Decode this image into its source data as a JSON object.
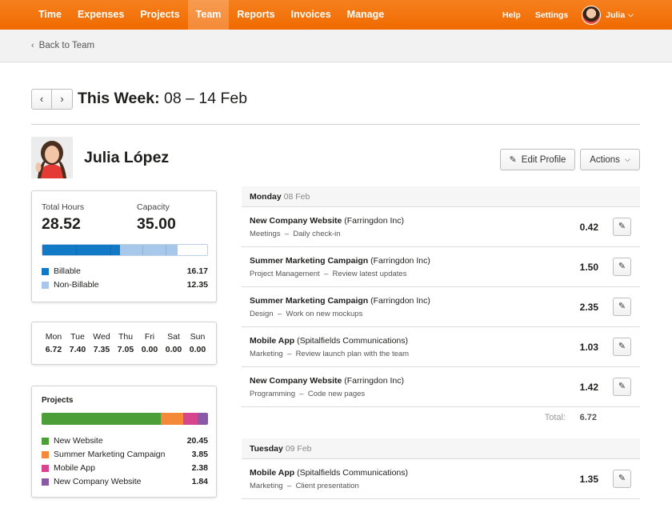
{
  "nav": {
    "items": [
      {
        "label": "Time"
      },
      {
        "label": "Expenses"
      },
      {
        "label": "Projects"
      },
      {
        "label": "Team"
      },
      {
        "label": "Reports"
      },
      {
        "label": "Invoices"
      },
      {
        "label": "Manage"
      }
    ],
    "active": "Team",
    "help": "Help",
    "settings": "Settings",
    "user": "Julia",
    "brand_color": "#f36c00"
  },
  "subbar": {
    "back_label": "Back to Team"
  },
  "week": {
    "prefix": "This Week:",
    "range": "08 – 14 Feb"
  },
  "person": {
    "name": "Julia López"
  },
  "actions": {
    "edit_profile": "Edit Profile",
    "actions": "Actions"
  },
  "hours": {
    "total_label": "Total Hours",
    "total_value": "28.52",
    "capacity_label": "Capacity",
    "capacity_value": "35.00",
    "billable_fraction": 0.47,
    "non_billable_fraction": 0.35,
    "billable_label": "Billable",
    "billable_value": "16.17",
    "non_billable_label": "Non-Billable",
    "non_billable_value": "12.35",
    "billable_color": "#1179c6",
    "non_billable_color": "#a7c8ea"
  },
  "days": [
    {
      "name": "Mon",
      "value": "6.72"
    },
    {
      "name": "Tue",
      "value": "7.40"
    },
    {
      "name": "Wed",
      "value": "7.35"
    },
    {
      "name": "Thu",
      "value": "7.05"
    },
    {
      "name": "Fri",
      "value": "0.00"
    },
    {
      "name": "Sat",
      "value": "0.00"
    },
    {
      "name": "Sun",
      "value": "0.00"
    }
  ],
  "projects": {
    "title": "Projects",
    "items": [
      {
        "name": "New Website",
        "value": "20.45",
        "color": "#4c9f38"
      },
      {
        "name": "Summer Marketing Campaign",
        "value": "3.85",
        "color": "#f5893a"
      },
      {
        "name": "Mobile App",
        "value": "2.38",
        "color": "#d8458f"
      },
      {
        "name": "New Company Website",
        "value": "1.84",
        "color": "#8b5aa6"
      }
    ]
  },
  "monday": {
    "day": "Monday",
    "date": "08 Feb",
    "entries": [
      {
        "project": "New Company Website",
        "client": "(Farringdon Inc)",
        "task": "Meetings",
        "note": "Daily check-in",
        "hours": "0.42"
      },
      {
        "project": "Summer Marketing Campaign",
        "client": "(Farringdon Inc)",
        "task": "Project Management",
        "note": "Review latest updates",
        "hours": "1.50"
      },
      {
        "project": "Summer Marketing Campaign",
        "client": "(Farringdon Inc)",
        "task": "Design",
        "note": "Work on new mockups",
        "hours": "2.35"
      },
      {
        "project": "Mobile App",
        "client": "(Spitalfields Communications)",
        "task": "Marketing",
        "note": "Review launch plan with the team",
        "hours": "1.03"
      },
      {
        "project": "New Company Website",
        "client": "(Farringdon Inc)",
        "task": "Programming",
        "note": "Code new pages",
        "hours": "1.42"
      }
    ],
    "total_label": "Total:",
    "total_value": "6.72"
  },
  "tuesday": {
    "day": "Tuesday",
    "date": "09 Feb",
    "entries": [
      {
        "project": "Mobile App",
        "client": "(Spitalfields Communications)",
        "task": "Marketing",
        "note": "Client presentation",
        "hours": "1.35"
      }
    ]
  }
}
